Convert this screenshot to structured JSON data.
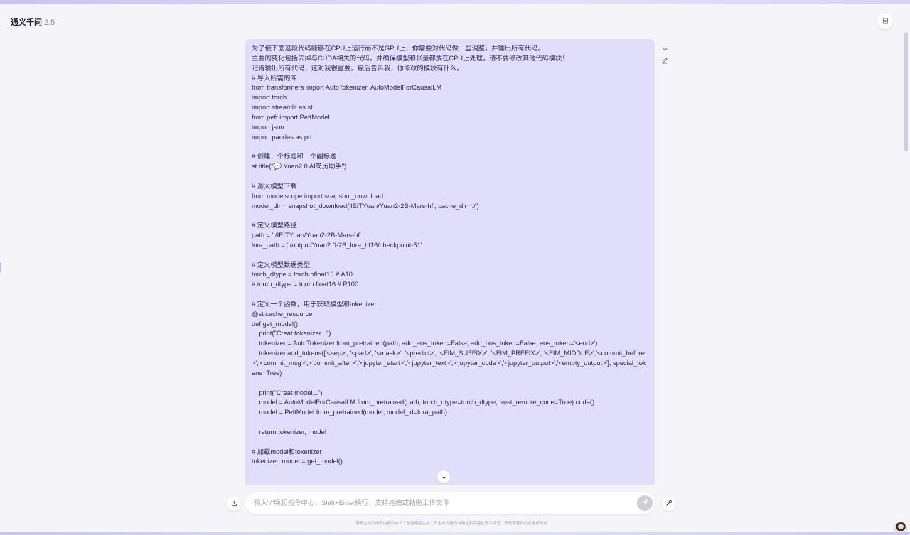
{
  "header": {
    "app_title": "通义千问",
    "app_version": "2.5"
  },
  "message": {
    "lines": [
      "为了使下面这段代码能够在CPU上运行而不是GPU上，你需要对代码做一些调整，并输出所有代码。",
      "主要的变化包括去掉与CUDA相关的代码，并确保模型和张量都放在CPU上处理，请不要修改其他代码模块！",
      "记得输出所有代码，这对我很重要。最后告诉我，你修改的模块有什么。",
      "# 导入所需的库",
      "from transformers import AutoTokenizer, AutoModelForCausalLM",
      "import torch",
      "import streamlit as st",
      "from peft import PeftModel",
      "import json",
      "import pandas as pd",
      "",
      "# 创建一个标题和一个副标题",
      "st.title(\"💬 Yuan2.0 AI简历助手\")",
      "",
      "# 源大模型下载",
      "from modelscope import snapshot_download",
      "model_dir = snapshot_download('IEITYuan/Yuan2-2B-Mars-hf', cache_dir='./')",
      "",
      "# 定义模型路径",
      "path = './IEITYuan/Yuan2-2B-Mars-hf'",
      "lora_path = './output/Yuan2.0-2B_lora_bf16/checkpoint-51'",
      "",
      "# 定义模型数据类型",
      "torch_dtype = torch.bfloat16 # A10",
      "# torch_dtype = torch.float16 # P100",
      "",
      "# 定义一个函数，用于获取模型和tokenizer",
      "@st.cache_resource",
      "def get_model():",
      "    print(\"Creat tokenizer...\")",
      "    tokenizer = AutoTokenizer.from_pretrained(path, add_eos_token=False, add_bos_token=False, eos_token='<eod>')",
      "    tokenizer.add_tokens(['<sep>', '<pad>', '<mask>', '<predict>', '<FIM_SUFFIX>', '<FIM_PREFIX>', '<FIM_MIDDLE>','<commit_before>','<commit_msg>','<commit_after>','<jupyter_start>','<jupyter_text>','<jupyter_code>','<jupyter_output>','<empty_output>'], special_tokens=True)",
      "",
      "    print(\"Creat model...\")",
      "    model = AutoModelForCausalLM.from_pretrained(path, torch_dtype=torch_dtype, trust_remote_code=True).cuda()",
      "    model = PeftModel.from_pretrained(model, model_id=lora_path)",
      "",
      "    return tokenizer, model",
      "",
      "# 加载model和tokenizer",
      "tokenizer, model = get_model()"
    ]
  },
  "composer": {
    "placeholder": "输入\"/\"唤起指令中心，Shift+Enter换行，支持拖拽或粘贴上传文件"
  },
  "footer": {
    "disclaimer": "服务生成的所有内容均由人工智能模型生成，其生成内容的准确性和完整性无法保证，不代表我们的态度或观点"
  },
  "icons": {
    "top_right": "document-icon",
    "collapse": "chevron-down-icon",
    "edit": "pencil-icon",
    "scroll_down": "arrow-down-icon",
    "upload": "upload-icon",
    "send": "send-icon",
    "tool": "magic-wand-icon"
  },
  "colors": {
    "bubble_bg": "#e0defb",
    "page_bg": "#f5f5f9",
    "accent": "#6c63e8"
  }
}
